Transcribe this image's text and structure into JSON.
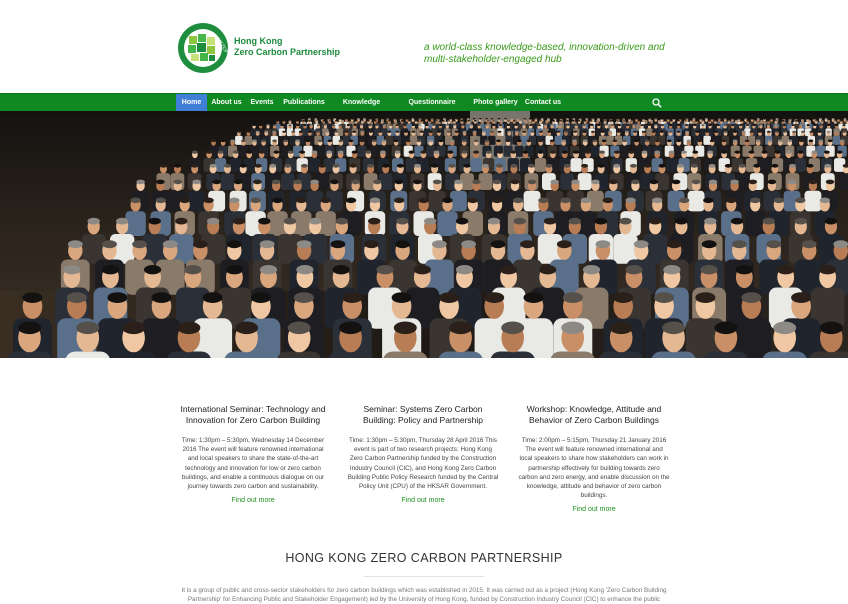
{
  "header": {
    "logo_line1": "Hong Kong",
    "logo_line2": "Zero Carbon Partnership",
    "logo_ring_text": "HKZCP",
    "tagline": "a world-class knowledge-based, innovation-driven and multi-stakeholder-engaged hub"
  },
  "nav": {
    "items": [
      {
        "label": "Home",
        "active": true
      },
      {
        "label": "About us"
      },
      {
        "label": "Events"
      },
      {
        "label": "Publications"
      },
      {
        "label": "Knowledge Centre"
      },
      {
        "label": "Questionnaire Survey"
      },
      {
        "label": "Photo gallery"
      },
      {
        "label": "Contact us"
      }
    ],
    "search_icon": "search-icon"
  },
  "hero": {
    "image": "photo of a seminar audience seated in a lecture hall"
  },
  "cards": [
    {
      "title": "International Seminar: Technology and Innovation for Zero Carbon Building",
      "body": "Time: 1:30pm – 5:30pm, Wednesday 14 December 2016 The event will feature renowned international and local speakers to share the state-of-the-art technology and innovation for low or zero carbon buildings, and enable a continuous dialogue on our journey towards zero carbon and sustainability.",
      "link": "Find out more"
    },
    {
      "title": "Seminar: Systems Zero Carbon Building: Policy and Partnership",
      "body": "Time: 1:30pm – 5:30pm, Thursday 28 April 2016 This event is part of two research projects: Hong Kong Zero Carbon Partnership funded by the Construction Industry Council (CIC), and Hong Kong Zero Carbon Building Public Policy Research funded by the Central Policy Unit (CPU) of the HKSAR Government.",
      "link": "Find out more"
    },
    {
      "title": "Workshop: Knowledge, Attitude and Behavior of Zero Carbon Buildings",
      "body": "Time: 2:00pm – 5:15pm, Thursday 21 January 2016 The event will feature renowned international and local speakers to share how stakeholders can work in partnership effectively for building towards zero carbon and zero energy, and enable discussion on the knowledge, attitude and behavior of zero carbon buildings.",
      "link": "Find out more"
    }
  ],
  "about": {
    "title": "HONG KONG ZERO CARBON PARTNERSHIP",
    "text": "It is a group of public and cross-sector stakeholders for zero carbon buildings which was established in 2015. It was carried out as a project (Hong Kong 'Zero Carbon Building Partnership' for Enhancing Public and Stakeholder Engagement) led by the University of Hong Kong, funded by Construction Industry Council (CIC) to enhance the public"
  },
  "colors": {
    "nav_green": "#0f8a22",
    "nav_active": "#3f7fd8",
    "link_green": "#1f8f1f",
    "tagline_green": "#3a9a1a",
    "logo_green": "#1c8a3c"
  }
}
